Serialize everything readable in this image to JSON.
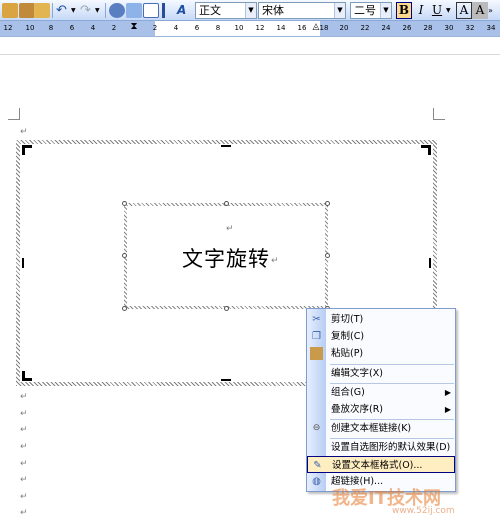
{
  "toolbar": {
    "style_combo": "正文",
    "font_combo": "宋体",
    "size_combo": "二号",
    "bold": "B",
    "italic": "I",
    "underline": "U",
    "font_color": "A",
    "char_border": "A",
    "char_shade": "A"
  },
  "ruler": {
    "ticks": [
      "12",
      "10",
      "8",
      "6",
      "4",
      "2",
      "2",
      "4",
      "6",
      "8",
      "10",
      "12",
      "14",
      "16",
      "18",
      "20",
      "22",
      "24",
      "26",
      "28",
      "30",
      "32",
      "34"
    ]
  },
  "document": {
    "textbox_text": "文字旋转",
    "para_mark": "↵"
  },
  "context_menu": {
    "items": [
      {
        "label": "剪切(T)",
        "icon": "scissors-icon"
      },
      {
        "label": "复制(C)",
        "icon": "copy-icon"
      },
      {
        "label": "粘贴(P)",
        "icon": "paste-icon"
      },
      {
        "label": "编辑文字(X)"
      },
      {
        "label": "组合(G)",
        "submenu": true
      },
      {
        "label": "叠放次序(R)",
        "submenu": true
      },
      {
        "label": "创建文本框链接(K)",
        "icon": "link-textbox-icon"
      },
      {
        "label": "设置自选图形的默认效果(D)"
      },
      {
        "label": "设置文本框格式(O)...",
        "icon": "format-textbox-icon",
        "highlighted": true
      },
      {
        "label": "超链接(H)...",
        "icon": "hyperlink-icon"
      }
    ]
  },
  "watermark": {
    "text": "我爱IT技术网",
    "url": "www.52ij.com"
  }
}
